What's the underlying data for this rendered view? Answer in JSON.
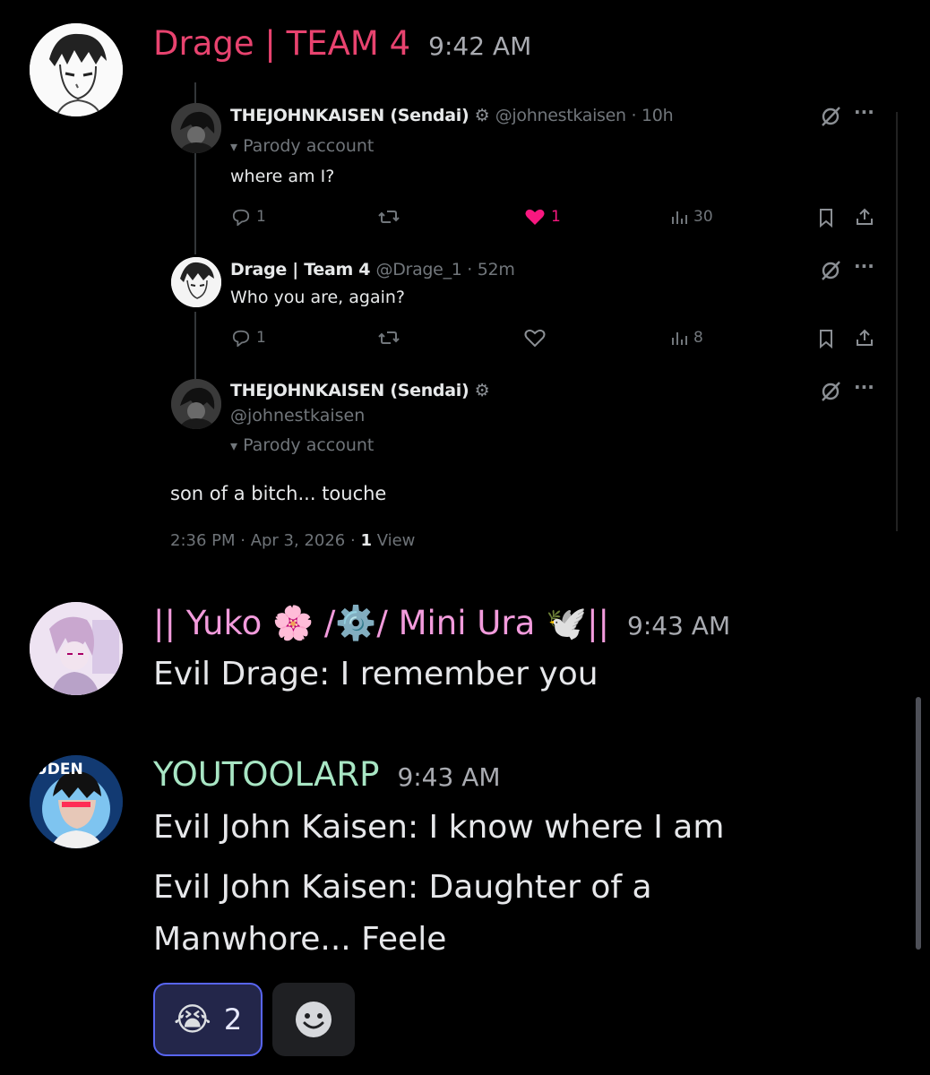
{
  "messages": [
    {
      "author": "Drage | TEAM 4",
      "time": "9:42 AM",
      "author_color": "#e8436f"
    },
    {
      "author": "|| Yuko 🌸 /⚙️/ Mini Ura 🕊️||",
      "time": "9:43 AM",
      "author_color": "#f29bdc",
      "text": "Evil Drage: I remember you"
    },
    {
      "author": "YOUTOOLARP",
      "time": "9:43 AM",
      "author_color": "#a8e6c4",
      "lines": [
        "Evil John Kaisen: I know where I am",
        "Evil John Kaisen: Daughter of a",
        "Manwhore... Feele"
      ]
    }
  ],
  "embed": {
    "tweets": [
      {
        "name": "THEJOHNKAISEN (Sendai)",
        "handle": "@johnestkaisen · 10h",
        "parody": "Parody account",
        "text": "where am I?",
        "replies": "1",
        "likes": "1",
        "views": "30"
      },
      {
        "name": "Drage | Team 4",
        "handle": "@Drage_1 · 52m",
        "text": "Who you are, again?",
        "replies": "1",
        "views": "8"
      },
      {
        "name": "THEJOHNKAISEN (Sendai)",
        "handle": "@johnestkaisen",
        "parody": "Parody account",
        "text": "son of a bitch... touche"
      }
    ],
    "footer_time": "2:36 PM · Apr 3, 2026 · ",
    "footer_views_count": "1",
    "footer_views_label": " View"
  },
  "reactions": [
    {
      "emoji": "😭",
      "count": "2"
    }
  ],
  "avatar_text": "UDEN",
  "icons": [
    "gear-icon",
    "grok-icon",
    "more-icon",
    "reply-icon",
    "retweet-icon",
    "heart-icon",
    "views-icon",
    "bookmark-icon",
    "share-icon",
    "mask-icon",
    "add-reaction-icon"
  ],
  "colors": {
    "drage": "#e8436f",
    "yuko": "#f29bdc",
    "youtoolarp": "#a8e6c4",
    "like": "#f91880",
    "reaction_border": "#5865f2"
  }
}
